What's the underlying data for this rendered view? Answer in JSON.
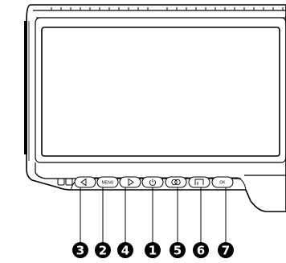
{
  "panel": {
    "buttons": [
      {
        "name": "left-arrow-button",
        "icon": "triangle-left-icon",
        "label": ""
      },
      {
        "name": "menu-button",
        "icon": "",
        "label": "MENU"
      },
      {
        "name": "right-arrow-button",
        "icon": "triangle-right-icon",
        "label": ""
      },
      {
        "name": "power-button",
        "icon": "power-icon",
        "label": ""
      },
      {
        "name": "input-button",
        "icon": "dual-ring-icon",
        "label": ""
      },
      {
        "name": "picture-button",
        "icon": "frame-icon",
        "label": ""
      },
      {
        "name": "ok-button",
        "icon": "",
        "label": "OK"
      }
    ]
  },
  "callouts": [
    "3",
    "2",
    "4",
    "1",
    "5",
    "6",
    "7"
  ],
  "colors": {
    "line": "#000000",
    "background": "#ffffff",
    "callout_fill": "#000000"
  }
}
